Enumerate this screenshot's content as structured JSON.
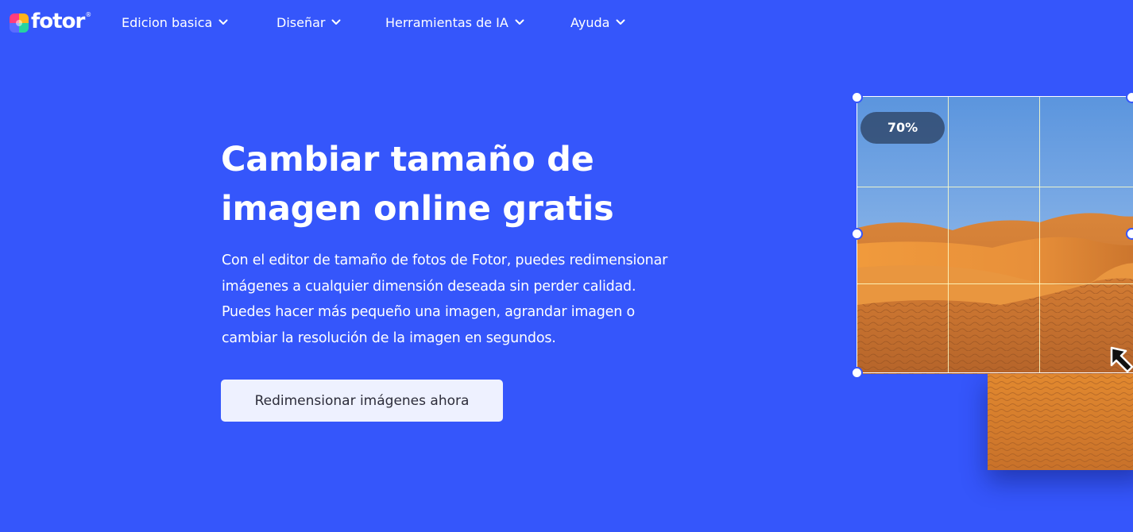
{
  "nav": {
    "logo_text": "fotor",
    "logo_mark": "®",
    "items": [
      {
        "label": "Edicion basica",
        "icon": "chevron-down-icon"
      },
      {
        "label": "Diseñar",
        "icon": "chevron-down-icon"
      },
      {
        "label": "Herramientas de IA",
        "icon": "chevron-down-icon"
      },
      {
        "label": "Ayuda",
        "icon": "chevron-down-icon"
      }
    ]
  },
  "hero": {
    "title_line1": "Cambiar tamaño de",
    "title_line2": "imagen online gratis",
    "description_lines": [
      "Con el editor de tamaño de fotos de Fotor, puedes redimensionar",
      "imágenes a cualquier dimensión deseada sin perder calidad.",
      "Puedes hacer más pequeño una imagen, agrandar imagen o",
      "cambiar la resolución de la imagen en segundos."
    ],
    "cta_label": "Redimensionar imágenes ahora"
  },
  "illustration": {
    "resize_percent": "70%",
    "photo_subject": "desert-dunes-photo",
    "cursor_icon": "resize-arrow-icon"
  },
  "colors": {
    "background": "#3556fb",
    "cta_background": "#eef1ff",
    "cta_text": "#2c2c3a",
    "sand": "#e48a2c",
    "sky": "#6ea3e6"
  }
}
